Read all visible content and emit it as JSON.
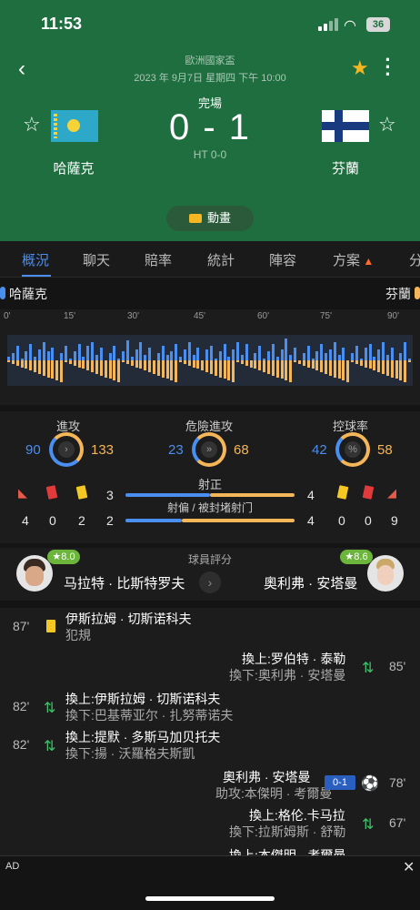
{
  "status_bar": {
    "time": "11:53",
    "battery": "36"
  },
  "match": {
    "league": "歐洲國家盃",
    "datetime": "2023 年 9月7日 星期四 下午 10:00",
    "status": "完場",
    "score": "0 - 1",
    "halftime": "HT 0-0",
    "home": "哈薩克",
    "away": "芬蘭",
    "animation_label": "動畫"
  },
  "tabs": [
    "概況",
    "聊天",
    "賠率",
    "統計",
    "陣容",
    "方案",
    "分"
  ],
  "timeline": {
    "home": "哈薩克",
    "away": "芬蘭",
    "ticks": [
      "0'",
      "15'",
      "30'",
      "45'",
      "60'",
      "75'",
      "90'"
    ]
  },
  "stats": {
    "attack": {
      "label": "進攻",
      "home": "90",
      "away": "133"
    },
    "danger": {
      "label": "危險進攻",
      "home": "23",
      "away": "68"
    },
    "possession": {
      "label": "控球率",
      "home": "42",
      "away": "58",
      "symbol": "%"
    },
    "on_target": {
      "label": "射正",
      "home": "3",
      "away": "4"
    },
    "off_target": {
      "label": "射偏 / 被封堵射门",
      "home": "2",
      "away": "4"
    },
    "home_cards": {
      "corners": "4",
      "red": "0",
      "yellow": "2"
    },
    "away_cards": {
      "yellow": "0",
      "red": "0",
      "corners": "9"
    }
  },
  "player_rating": {
    "label": "球員評分",
    "home_player": "马拉特 · 比斯特罗夫",
    "home_rating": "★8.0",
    "away_player": "奧利弗 · 安塔曼",
    "away_rating": "★8.6"
  },
  "events": [
    {
      "time": "87'",
      "line1": "伊斯拉姆 · 切斯诺科夫",
      "line2": "犯規"
    },
    {
      "time": "85'",
      "line1": "換上:罗伯特 · 泰勒",
      "line2": "換下:奧利弗 · 安塔曼"
    },
    {
      "time": "82'",
      "line1": "換上:伊斯拉姆 · 切斯诺科夫",
      "line2": "換下:巴基蒂亚尔 · 扎努蒂诺夫"
    },
    {
      "time": "82'",
      "line1": "換上:提默 · 多斯马加贝托夫",
      "line2": "換下:揚 · 沃羅格夫斯凱"
    },
    {
      "time": "78'",
      "line1": "奧利弗 · 安塔曼",
      "line2": "助攻:本傑明 · 考爾曼",
      "score": "0-1"
    },
    {
      "time": "67'",
      "line1": "換上:格伦.卡马拉",
      "line2": "換下:拉斯姆斯 · 舒勒"
    },
    {
      "time": "",
      "line1": "換上:本傑明 · 考爾曼",
      "line2": ""
    }
  ],
  "ad": {
    "label": "AD"
  }
}
